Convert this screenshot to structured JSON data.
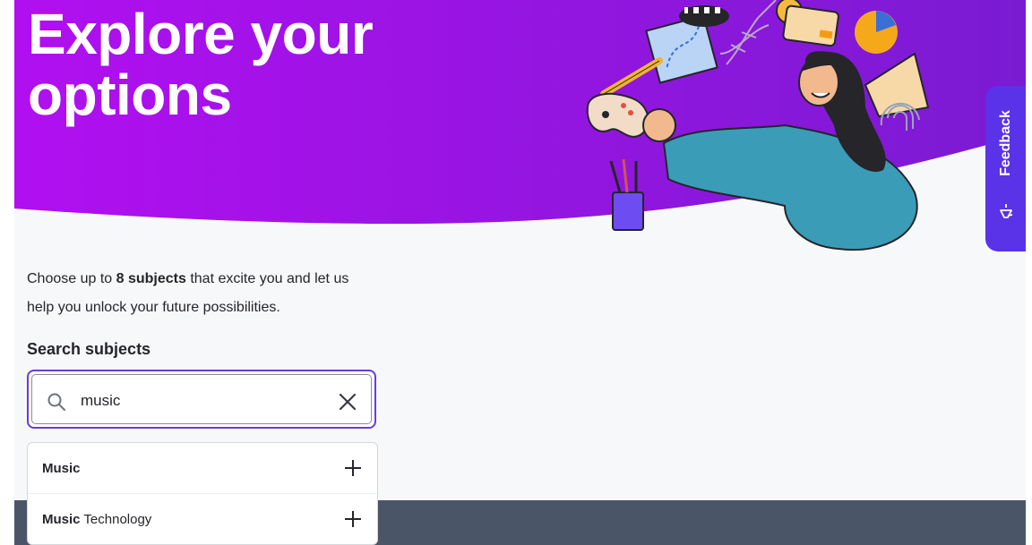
{
  "hero": {
    "title": "Explore your options",
    "gradient_start": "#b10ff0",
    "gradient_end": "#7a1bd2"
  },
  "intro": {
    "text_before": "Choose up to ",
    "emphasis": "8 subjects",
    "text_after": " that excite you and let us help you unlock your future possibilities."
  },
  "search": {
    "label": "Search subjects",
    "value": "music",
    "icon": "search-icon",
    "clear_icon": "close-icon",
    "border_color": "#6a3bd9"
  },
  "results": [
    {
      "match": "Music",
      "rest": "",
      "action_icon": "plus-icon"
    },
    {
      "match": "Music",
      "rest": " Technology",
      "action_icon": "plus-icon"
    }
  ],
  "feedback": {
    "label": "Feedback",
    "icon": "megaphone-icon",
    "color": "#5a32e8"
  },
  "footer": {
    "color": "#4a5568"
  }
}
